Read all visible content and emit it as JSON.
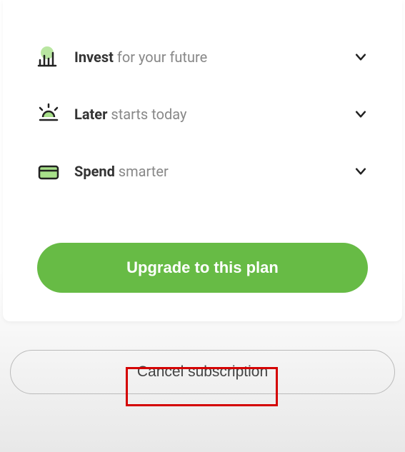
{
  "features": [
    {
      "icon": "chart-icon",
      "bold": "Invest",
      "rest": " for your future"
    },
    {
      "icon": "sunrise-icon",
      "bold": "Later",
      "rest": " starts today"
    },
    {
      "icon": "card-icon",
      "bold": "Spend",
      "rest": " smarter"
    }
  ],
  "upgrade_label": "Upgrade to this plan",
  "cancel_label": "Cancel subscription",
  "colors": {
    "accent": "#67bb45",
    "highlight": "#d40000"
  }
}
